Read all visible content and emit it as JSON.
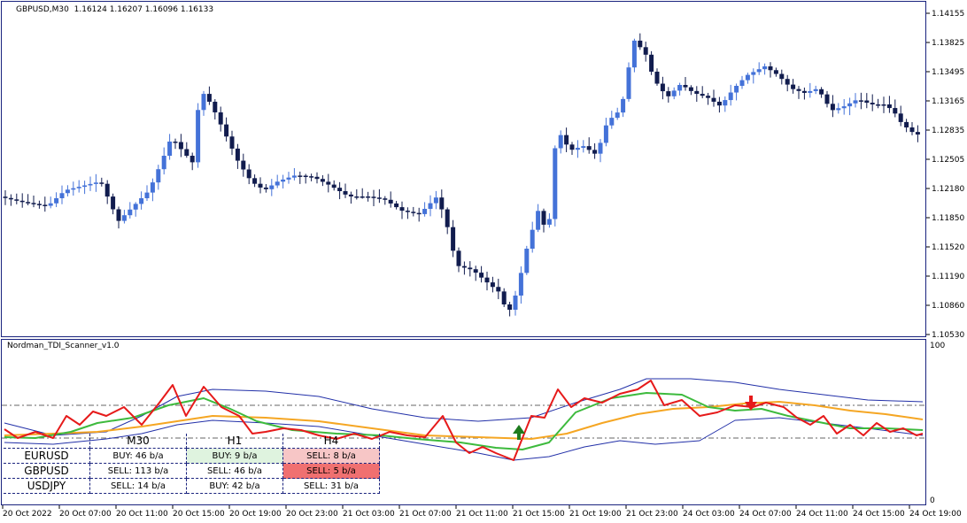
{
  "chart_header": {
    "symbol": "GBPUSD,M30",
    "ohlc": "1.16124 1.16207 1.16096 1.16133"
  },
  "colors": {
    "bull": "#4472d8",
    "bear": "#111c4e",
    "rsi": "#e61a1a",
    "signal": "#3dba3d",
    "trade": "#f5a623",
    "band": "#2230a8",
    "up_arrow": "#1e7b1e",
    "down_arrow": "#e61a1a"
  },
  "price_axis": [
    "1.14155",
    "1.13825",
    "1.13495",
    "1.13165",
    "1.12835",
    "1.12505",
    "1.12180",
    "1.11850",
    "1.11520",
    "1.11190",
    "1.10860",
    "1.10530"
  ],
  "indicator": {
    "name": "Nordman_TDI_Scanner_v1.0",
    "scale_top": "100",
    "scale_bottom": "0"
  },
  "time_axis": [
    "20 Oct 2022",
    "20 Oct 07:00",
    "20 Oct 11:00",
    "20 Oct 15:00",
    "20 Oct 19:00",
    "20 Oct 23:00",
    "21 Oct 03:00",
    "21 Oct 07:00",
    "21 Oct 11:00",
    "21 Oct 15:00",
    "21 Oct 19:00",
    "21 Oct 23:00",
    "24 Oct 03:00",
    "24 Oct 07:00",
    "24 Oct 11:00",
    "24 Oct 15:00",
    "24 Oct 19:00"
  ],
  "scanner": {
    "timeframes": [
      "M30",
      "H1",
      "H4"
    ],
    "rows": [
      {
        "pair": "EURUSD",
        "cells": [
          {
            "text": "BUY: 46 b/a",
            "bg": "#ffffff"
          },
          {
            "text": "BUY: 9 b/a",
            "bg": "#dff3df"
          },
          {
            "text": "SELL: 8 b/a",
            "bg": "#f7c6c6"
          }
        ]
      },
      {
        "pair": "GBPUSD",
        "cells": [
          {
            "text": "SELL: 113 b/a",
            "bg": "#ffffff"
          },
          {
            "text": "SELL: 46 b/a",
            "bg": "#ffffff"
          },
          {
            "text": "SELL: 5 b/a",
            "bg": "#f07070"
          }
        ]
      },
      {
        "pair": "USDJPY",
        "cells": [
          {
            "text": "SELL: 14 b/a",
            "bg": "#ffffff"
          },
          {
            "text": "BUY: 42 b/a",
            "bg": "#ffffff"
          },
          {
            "text": "SELL: 31 b/a",
            "bg": "#ffffff"
          }
        ]
      }
    ]
  }
}
